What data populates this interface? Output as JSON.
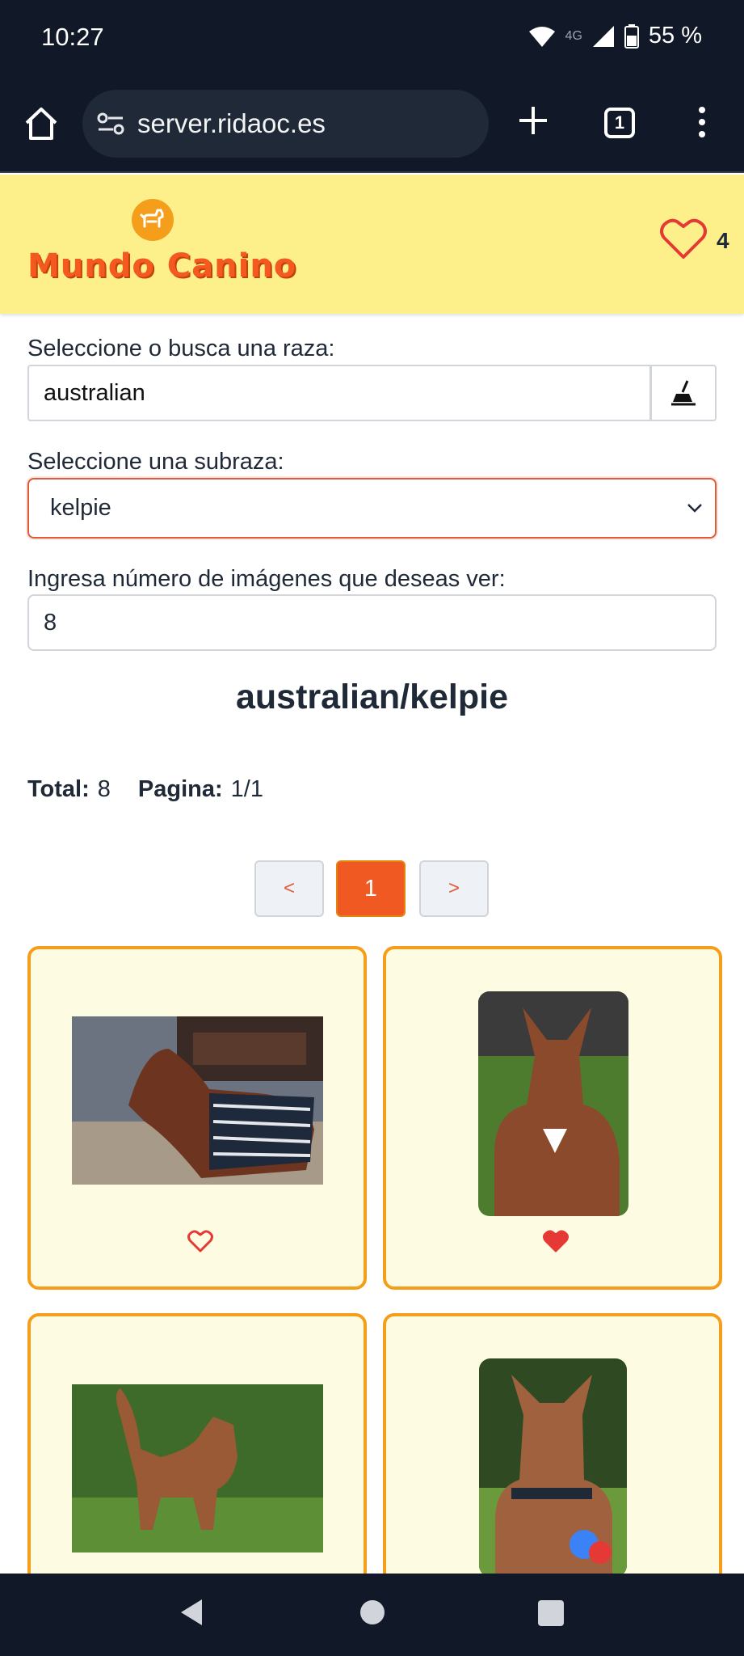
{
  "status_bar": {
    "time": "10:27",
    "network": "4G",
    "battery": "55 %"
  },
  "browser": {
    "url": "server.ridaoc.es",
    "tab_count": "1"
  },
  "header": {
    "logo_text": "Mundo Canino",
    "favorites_count": "4"
  },
  "form": {
    "breed_label": "Seleccione o busca una raza:",
    "breed_value": "australian",
    "subbreed_label": "Seleccione una subraza:",
    "subbreed_value": "kelpie",
    "count_label": "Ingresa número de imágenes que deseas ver:",
    "count_value": "8"
  },
  "results": {
    "title": "australian/kelpie",
    "total_label": "Total:",
    "total_value": "8",
    "page_label": "Pagina:",
    "page_value": "1/1"
  },
  "pagination": {
    "prev": "<",
    "current": "1",
    "next": ">"
  },
  "gallery": [
    {
      "favorite": false
    },
    {
      "favorite": true
    },
    {
      "favorite": false
    },
    {
      "favorite": false
    }
  ],
  "colors": {
    "accent": "#f05a22",
    "header_bg": "#fdf08a",
    "card_border": "#f59e1b",
    "heart": "#e53935"
  }
}
